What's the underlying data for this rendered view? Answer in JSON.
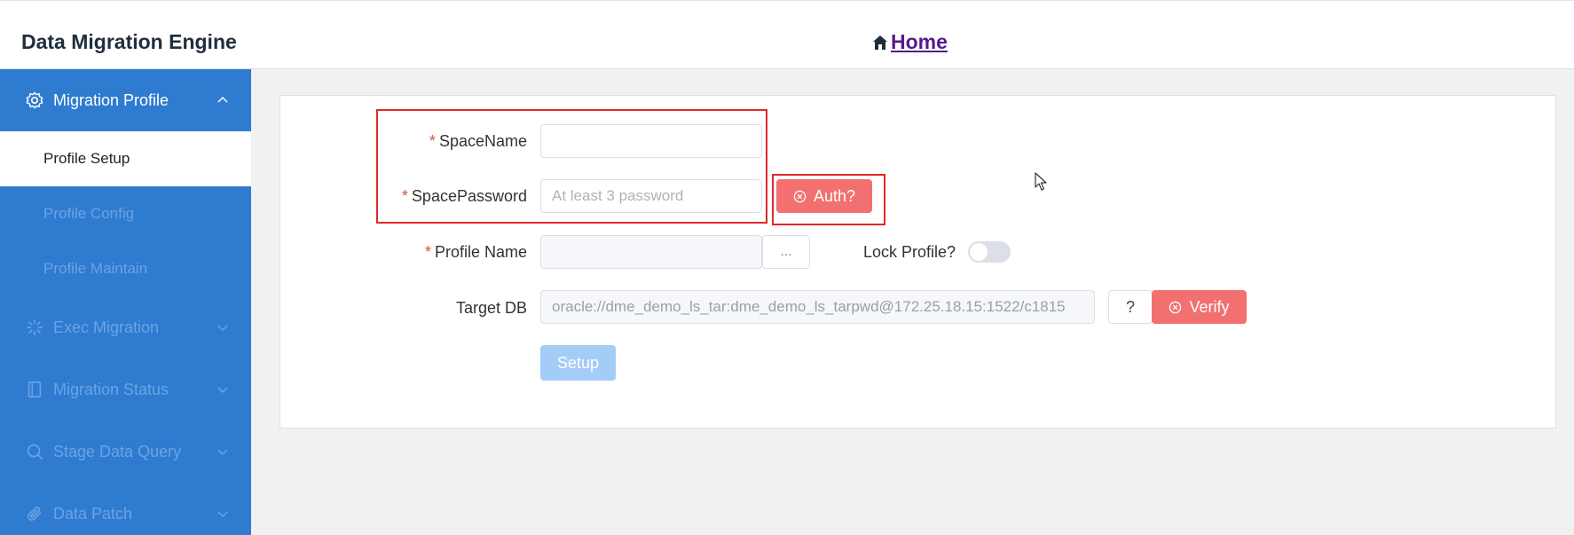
{
  "header": {
    "app_title": "Data Migration Engine",
    "home_label": "Home"
  },
  "sidebar": {
    "groups": [
      {
        "label": "Migration Profile",
        "icon": "gear-icon",
        "expanded": true
      },
      {
        "label": "Exec Migration",
        "icon": "loading-icon",
        "expanded": false
      },
      {
        "label": "Migration Status",
        "icon": "notebook-icon",
        "expanded": false
      },
      {
        "label": "Stage Data Query",
        "icon": "search-icon",
        "expanded": false
      },
      {
        "label": "Data Patch",
        "icon": "paperclip-icon",
        "expanded": false
      }
    ],
    "profile_items": [
      {
        "label": "Profile Setup",
        "active": true
      },
      {
        "label": "Profile Config",
        "active": false
      },
      {
        "label": "Profile Maintain",
        "active": false
      }
    ]
  },
  "form": {
    "space_name_label": "SpaceName",
    "space_name_value": "",
    "space_password_label": "SpacePassword",
    "space_password_placeholder": "At least 3 password",
    "auth_button": "Auth?",
    "profile_name_label": "Profile Name",
    "profile_name_value": "",
    "ellipsis_button": "...",
    "lock_profile_label": "Lock Profile?",
    "lock_profile_on": false,
    "target_db_label": "Target DB",
    "target_db_value": "oracle://dme_demo_ls_tar:dme_demo_ls_tarpwd@172.25.18.15:1522/c1815",
    "help_button": "?",
    "verify_button": "Verify",
    "setup_button": "Setup",
    "required_mark": "*"
  },
  "colors": {
    "sidebar_bg": "#2f7bd0",
    "danger": "#f27070",
    "primary_disabled": "#a3cdf6",
    "highlight": "#e0282a"
  }
}
